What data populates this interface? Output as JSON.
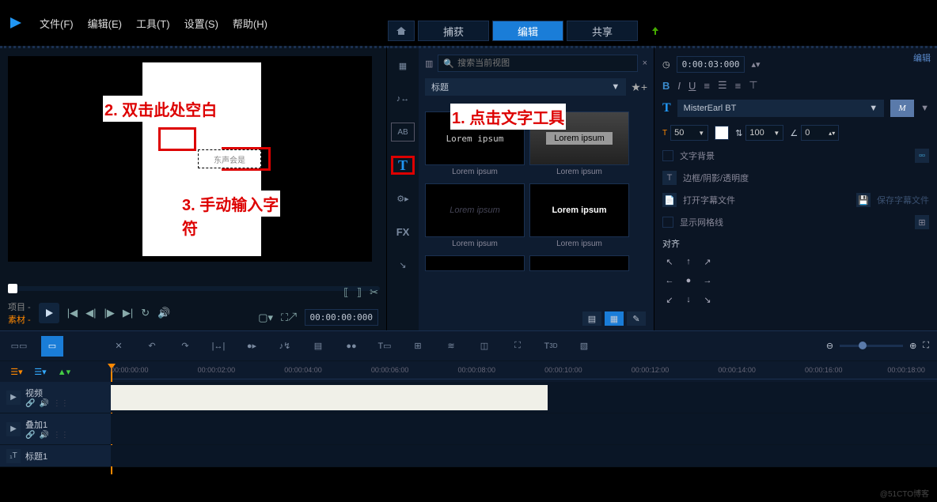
{
  "menu": {
    "file": "文件(F)",
    "edit": "编辑(E)",
    "tools": "工具(T)",
    "settings": "设置(S)",
    "help": "帮助(H)"
  },
  "tabs": {
    "capture": "捕获",
    "edit": "编辑",
    "share": "共享"
  },
  "annotations": {
    "a1": "1. 点击文字工具",
    "a2": "2. 双击此处空白",
    "a3": "3. 手动输入字",
    "a3b": "符"
  },
  "preview": {
    "project_label": "项目 -",
    "material_label": "素材 -",
    "time_bracket": "[     ]",
    "time": "00:00:00:000",
    "text_sample": "东声会是"
  },
  "library": {
    "search_icon": "🔍",
    "search_placeholder": "搜索当前视图",
    "category": "标题",
    "thumbs": [
      {
        "text": "Lorem ipsum",
        "label": "Lorem ipsum",
        "style": "plain"
      },
      {
        "text": "Lorem ipsum",
        "label": "Lorem ipsum",
        "style": "highlight"
      },
      {
        "text": "Lorem ipsum",
        "label": "Lorem ipsum",
        "style": "italic-dim"
      },
      {
        "text": "Lorem ipsum",
        "label": "Lorem ipsum",
        "style": "bold-outline"
      }
    ]
  },
  "props": {
    "tab_label": "编辑",
    "time": "0:00:03:000",
    "font": "MisterEarl BT",
    "font_preview": "M",
    "size": "50",
    "line_h": "100",
    "angle": "0",
    "opt_bg": "文字背景",
    "opt_border": "边框/阴影/透明度",
    "opt_subtitle": "打开字幕文件",
    "opt_save_subtitle": "保存字幕文件",
    "opt_grid": "显示网格线",
    "align_label": "对齐"
  },
  "timeline": {
    "ticks": [
      "00:00:00:00",
      "00:00:02:00",
      "00:00:04:00",
      "00:00:06:00",
      "00:00:08:00",
      "00:00:10:00",
      "00:00:12:00",
      "00:00:14:00",
      "00:00:16:00",
      "00:00:18:00"
    ],
    "tracks": [
      {
        "name": "视频"
      },
      {
        "name": "叠加1"
      },
      {
        "name": "标题1"
      }
    ]
  },
  "watermark": "@51CTO博客"
}
